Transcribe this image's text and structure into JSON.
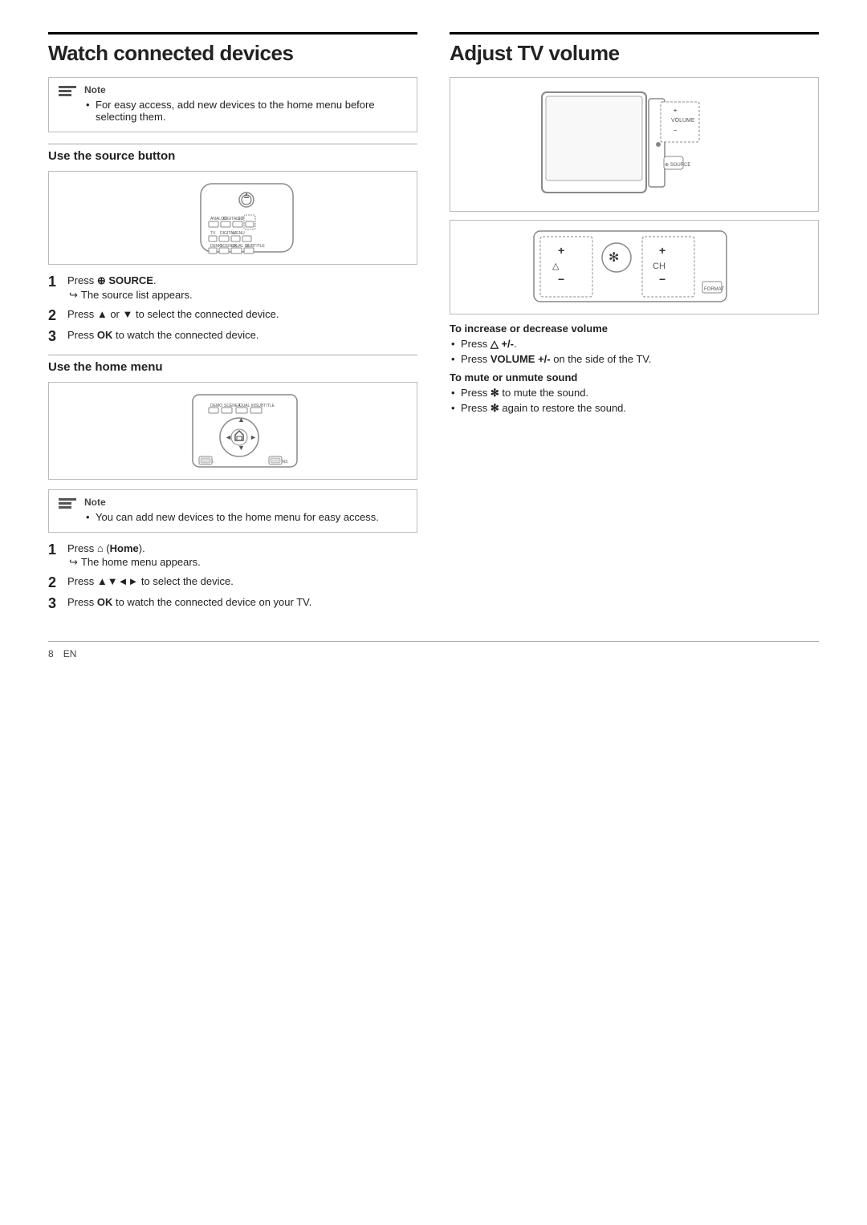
{
  "page": {
    "footer": {
      "page_num": "8",
      "lang": "EN"
    }
  },
  "left": {
    "section_title": "Watch connected devices",
    "note1": {
      "label": "Note",
      "text": "For easy access, add new devices to the home menu before selecting them."
    },
    "subsection1": {
      "title": "Use the source button",
      "steps": [
        {
          "num": "1",
          "text": "Press ⊕ SOURCE.",
          "substeps": [
            "The source list appears."
          ]
        },
        {
          "num": "2",
          "text": "Press ▲ or ▼ to select the connected device."
        },
        {
          "num": "3",
          "text": "Press OK to watch the connected device."
        }
      ]
    },
    "subsection2": {
      "title": "Use the home menu",
      "note": {
        "label": "Note",
        "text": "You can add new devices to the home menu for easy access."
      },
      "steps": [
        {
          "num": "1",
          "text": "Press ⌂ (Home).",
          "substeps": [
            "The home menu appears."
          ]
        },
        {
          "num": "2",
          "text": "Press ▲▼◄► to select the device."
        },
        {
          "num": "3",
          "text": "Press OK to watch the connected device on your TV."
        }
      ]
    }
  },
  "right": {
    "section_title": "Adjust TV volume",
    "increase_heading": "To increase or decrease volume",
    "increase_bullets": [
      "Press △ +/-.",
      "Press VOLUME +/- on the side of the TV."
    ],
    "mute_heading": "To mute or unmute sound",
    "mute_bullets": [
      "Press ✻ to mute the sound.",
      "Press ✻ again to restore the sound."
    ]
  }
}
